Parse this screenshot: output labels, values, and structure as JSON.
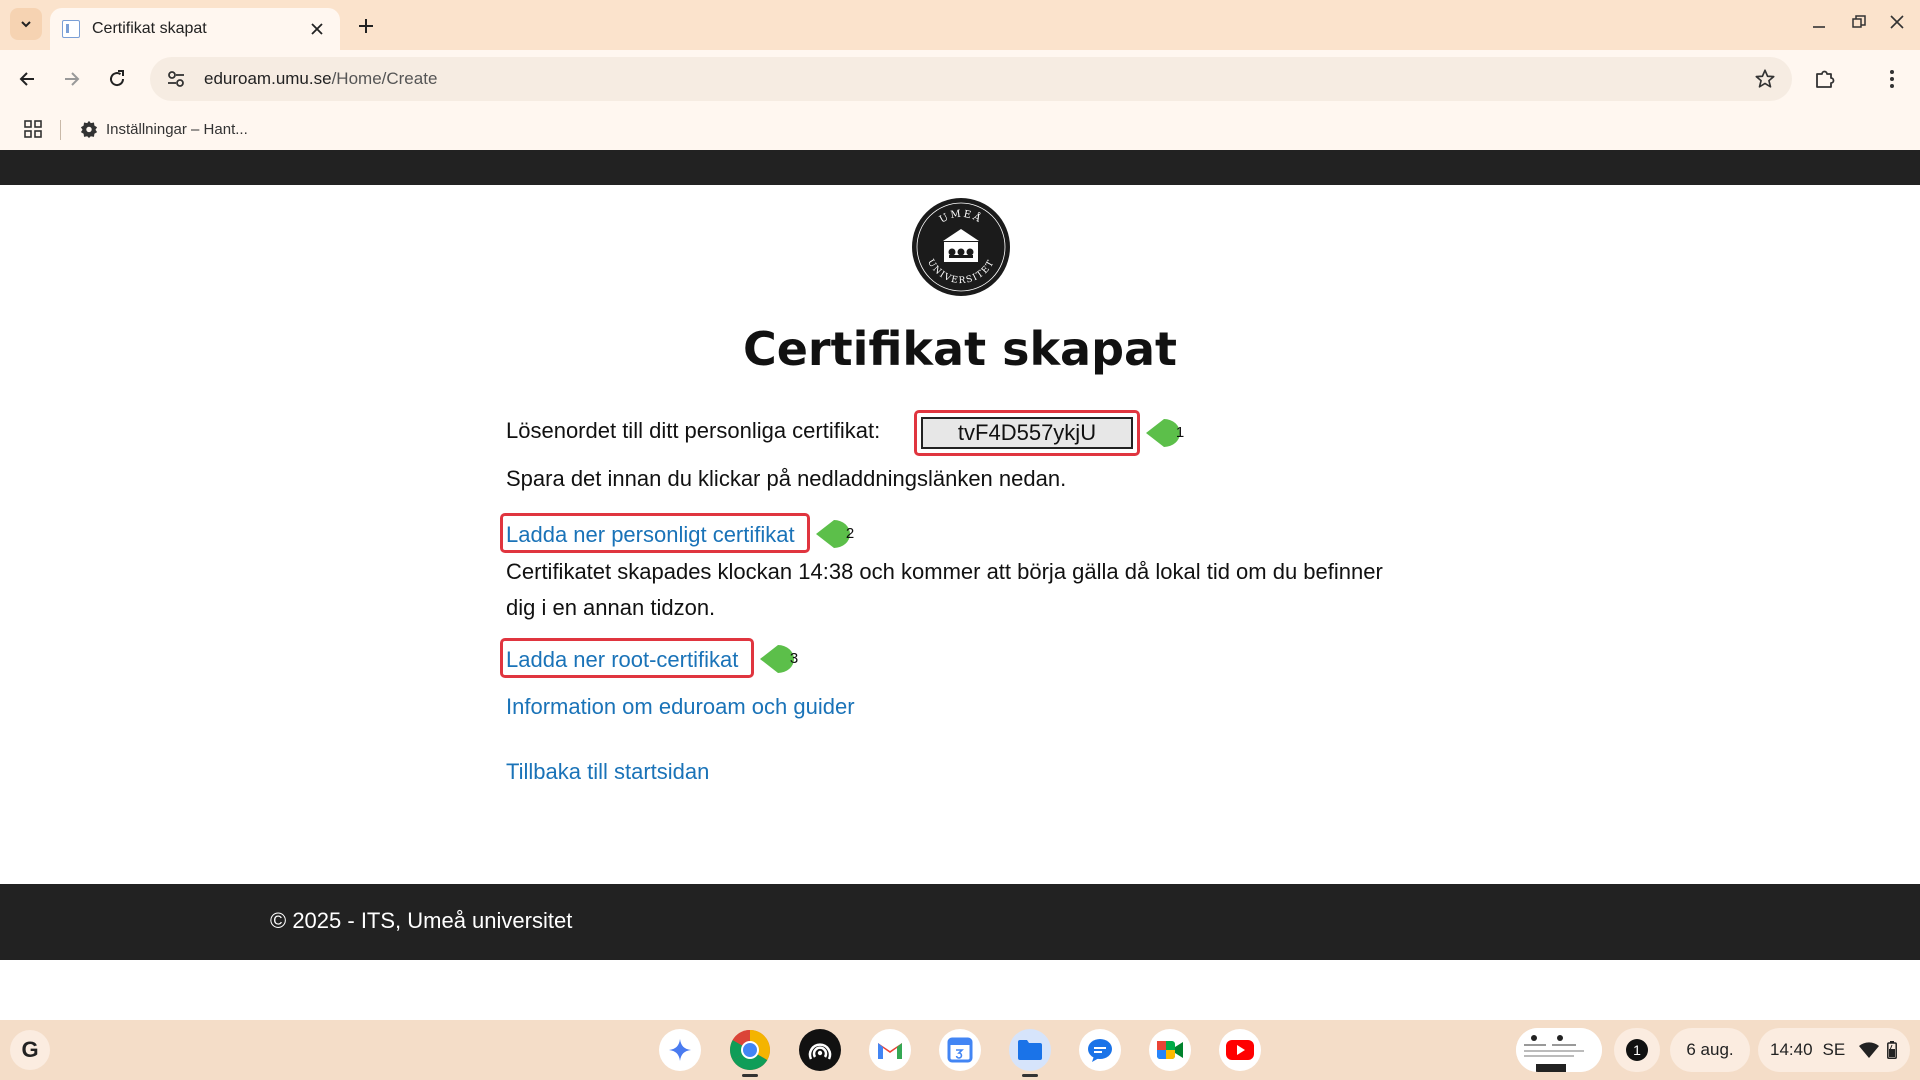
{
  "browser": {
    "tab_title": "Certifikat skapat",
    "url_host": "eduroam.umu.se",
    "url_path": "/Home/Create",
    "bookmark_label": "Inställningar – Hant..."
  },
  "page": {
    "title": "Certifikat skapat",
    "logo_top_text": "UMEÅ",
    "logo_bottom_text": "UNIVERSITET",
    "password_label": "Lösenordet till ditt personliga certifikat:",
    "password_value": "tvF4D557ykjU",
    "save_note": "Spara det innan du klickar på nedladdningslänken nedan.",
    "download_personal": "Ladda ner personligt certifikat",
    "cert_note": "Certifikatet skapades klockan 14:38 och kommer att börja gälla då lokal tid om du befinner dig i en annan tidzon.",
    "download_root": "Ladda ner root-certifikat",
    "info_link": "Information om eduroam och guider",
    "back_link": "Tillbaka till startsidan",
    "callouts": [
      "1",
      "2",
      "3"
    ]
  },
  "footer": {
    "text": "© 2025 - ITS, Umeå universitet"
  },
  "shelf": {
    "launcher": "G",
    "notification_count": "1",
    "date": "6 aug.",
    "time": "14:40",
    "locale": "SE"
  },
  "colors": {
    "link": "#1a73b8",
    "highlight_border": "#e0353f",
    "callout": "#5cbf4a",
    "dark_bar": "#222222",
    "tabstrip": "#fbe3cc"
  }
}
